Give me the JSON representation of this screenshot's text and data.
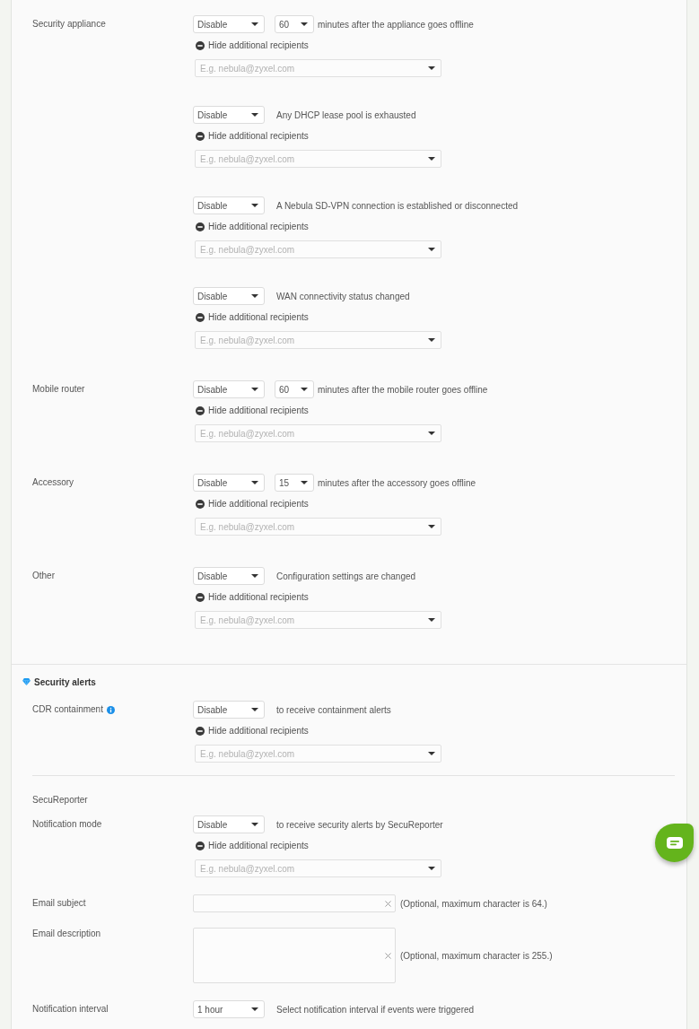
{
  "offline_alerts": [
    {
      "label": "Security appliance",
      "events": [
        {
          "mode": "Disable",
          "minutes": "60",
          "text": "minutes after the appliance goes offline",
          "toggle": "Hide additional recipients",
          "expanded": true,
          "recipients": {
            "placeholder": "E.g. nebula@zyxel.com"
          }
        },
        {
          "mode": "Disable",
          "text": "Any DHCP lease pool is exhausted",
          "toggle": "Hide additional recipients",
          "expanded": true,
          "recipients": {
            "placeholder": "E.g. nebula@zyxel.com"
          }
        },
        {
          "mode": "Disable",
          "text": "A Nebula SD-VPN connection is established or disconnected",
          "toggle": "Hide additional recipients",
          "expanded": true,
          "recipients": {
            "placeholder": "E.g. nebula@zyxel.com"
          }
        },
        {
          "mode": "Disable",
          "text": "WAN connectivity status changed",
          "toggle": "Hide additional recipients",
          "expanded": true,
          "recipients": {
            "placeholder": "E.g. nebula@zyxel.com"
          }
        }
      ]
    },
    {
      "label": "Mobile router",
      "events": [
        {
          "mode": "Disable",
          "minutes": "60",
          "text": "minutes after the mobile router goes offline",
          "toggle": "Hide additional recipients",
          "expanded": true,
          "recipients": {
            "placeholder": "E.g. nebula@zyxel.com"
          }
        }
      ]
    },
    {
      "label": "Accessory",
      "events": [
        {
          "mode": "Disable",
          "minutes": "15",
          "text": "minutes after the accessory goes offline",
          "toggle": "Hide additional recipients",
          "expanded": true,
          "recipients": {
            "placeholder": "E.g. nebula@zyxel.com"
          }
        }
      ]
    },
    {
      "label": "Other",
      "events": [
        {
          "mode": "Disable",
          "text": "Configuration settings are changed",
          "toggle": "Hide additional recipients",
          "expanded": true,
          "recipients": {
            "placeholder": "E.g. nebula@zyxel.com"
          }
        }
      ]
    }
  ],
  "security_alerts": {
    "title": "Security alerts",
    "rows": [
      {
        "kind": "alert",
        "label": "CDR containment",
        "info": true,
        "mode": "Disable",
        "text": "to receive containment alerts",
        "toggle": "Hide additional recipients",
        "expanded": true,
        "recipients": {
          "placeholder": "E.g. nebula@zyxel.com"
        }
      },
      {
        "kind": "subheading",
        "label": "SecuReporter"
      },
      {
        "kind": "alert",
        "label": "Notification mode",
        "info": false,
        "mode": "Disable",
        "text": "to receive security alerts by SecuReporter",
        "toggle": "Hide additional recipients",
        "expanded": true,
        "recipients": {
          "placeholder": "E.g. nebula@zyxel.com"
        }
      },
      {
        "kind": "text_field",
        "label": "Email subject",
        "hint": "(Optional, maximum character is 64.)"
      },
      {
        "kind": "text_area",
        "label": "Email description",
        "hint": "(Optional, maximum character is 255.)"
      },
      {
        "kind": "select",
        "label": "Notification interval",
        "value": "1 hour",
        "text": "Select notification interval if events were triggered"
      }
    ]
  }
}
